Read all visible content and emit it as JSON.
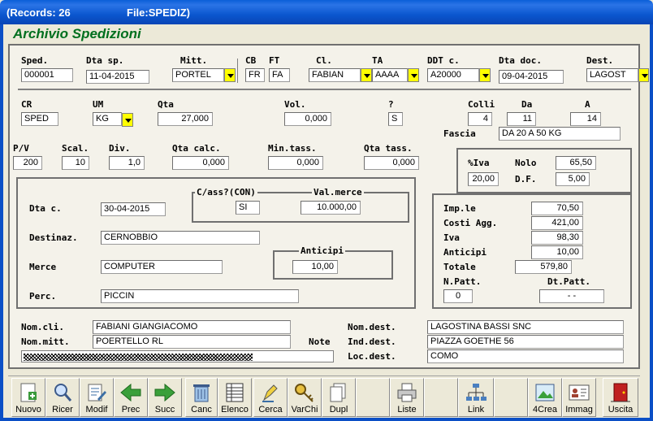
{
  "window": {
    "records": "(Records: 26",
    "file": "File:SPEDIZ)",
    "app_title": "Archivio Spedizioni"
  },
  "colors": {
    "title_green": "#006f1e",
    "dropdown_yellow": "#ffff00",
    "titlebar_blue": "#0b57cf"
  },
  "row1": {
    "sped_label": "Sped.",
    "sped": "000001",
    "dta_sp_label": "Dta sp.",
    "dta_sp": "11-04-2015",
    "mitt_label": "Mitt.",
    "mitt": "PORTEL",
    "cb_label": "CB",
    "cb": "FR",
    "ft_label": "FT",
    "ft": "FA",
    "cl_label": "Cl.",
    "cl": "FABIAN",
    "ta_label": "TA",
    "ta": "AAAA",
    "ddt_label": "DDT c.",
    "ddt": "A20000",
    "dta_doc_label": "Dta doc.",
    "dta_doc": "09-04-2015",
    "dest_label": "Dest.",
    "dest": "LAGOST"
  },
  "row2": {
    "cr_label": "CR",
    "cr": "SPED",
    "um_label": "UM",
    "um": "KG",
    "qta_label": "Qta",
    "qta": "27,000",
    "vol_label": "Vol.",
    "vol": "0,000",
    "q_label": "?",
    "q": "S",
    "colli_label": "Colli",
    "colli": "4",
    "da_label": "Da",
    "da": "11",
    "a_label": "A",
    "a": "14",
    "fascia_label": "Fascia",
    "fascia": "DA 20 A 50 KG"
  },
  "row3": {
    "pv_label": "P/V",
    "pv": "200",
    "scal_label": "Scal.",
    "scal": "10",
    "div_label": "Div.",
    "div": "1,0",
    "qta_calc_label": "Qta calc.",
    "qta_calc": "0,000",
    "min_tass_label": "Min.tass.",
    "min_tass": "0,000",
    "qta_tass_label": "Qta tass.",
    "qta_tass": "0,000"
  },
  "iva_box": {
    "iva_label": "%Iva",
    "iva": "20,00",
    "nolo_label": "Nolo",
    "nolo": "65,50",
    "df_label": "D.F.",
    "df": "5,00"
  },
  "left_box": {
    "dta_c_label": "Dta c.",
    "dta_c": "30-04-2015",
    "cass_caption": "C/ass?(CON)",
    "cass": "SI",
    "val_merce_caption": "Val.merce",
    "val_merce": "10.000,00",
    "destinaz_label": "Destinaz.",
    "destinaz": "CERNOBBIO",
    "anticipi_caption": "Anticipi",
    "anticipi": "10,00",
    "merce_label": "Merce",
    "merce": "COMPUTER",
    "perc_label": "Perc.",
    "perc": "PICCIN"
  },
  "totals": {
    "imp_label": "Imp.le",
    "imp": "70,50",
    "costi_label": "Costi Agg.",
    "costi": "421,00",
    "iva_label": "Iva",
    "iva": "98,30",
    "anticipi_label": "Anticipi",
    "anticipi": "10,00",
    "totale_label": "Totale",
    "totale": "579,80",
    "npatt_label": "N.Patt.",
    "npatt": "0",
    "dtpatt_label": "Dt.Patt.",
    "dtpatt": "-   -"
  },
  "bottom": {
    "nom_cli_label": "Nom.cli.",
    "nom_cli": "FABIANI GIANGIACOMO",
    "nom_mitt_label": "Nom.mitt.",
    "nom_mitt": "POERTELLO RL",
    "note_label": "Note",
    "nom_dest_label": "Nom.dest.",
    "nom_dest": "LAGOSTINA BASSI SNC",
    "ind_dest_label": "Ind.dest.",
    "ind_dest": "PIAZZA GOETHE 56",
    "loc_dest_label": "Loc.dest.",
    "loc_dest": "COMO"
  },
  "toolbar": {
    "nuovo": "Nuovo",
    "ricer": "Ricer",
    "modif": "Modif",
    "prec": "Prec",
    "succ": "Succ",
    "canc": "Canc",
    "elenco": "Elenco",
    "cerca": "Cerca",
    "varchi": "VarChi",
    "dupl": "Dupl",
    "liste": "Liste",
    "link": "Link",
    "crea4": "4Crea",
    "immag": "Immag",
    "uscita": "Uscita"
  }
}
